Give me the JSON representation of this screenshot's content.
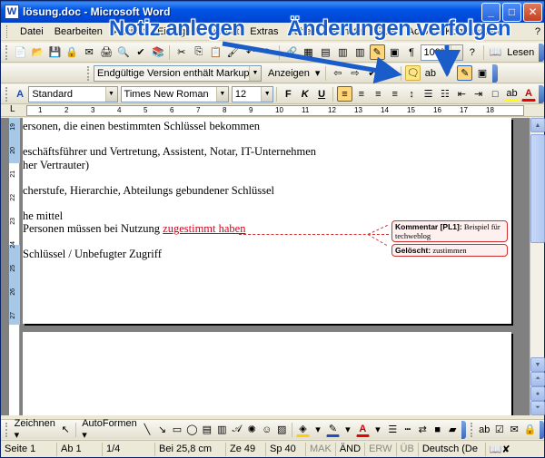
{
  "window": {
    "title": "lösung.doc - Microsoft Word",
    "minimize": "_",
    "maximize": "□",
    "close": "✕"
  },
  "menu": {
    "items": [
      "Datei",
      "Bearbeiten",
      "Ansicht",
      "Einfügen",
      "Format",
      "Extras",
      "Tabelle",
      "Fenster",
      "PDF",
      "Acrobat-Kommentare",
      "?"
    ],
    "help_search": "?"
  },
  "standard_toolbar": {
    "zoom": "100%",
    "read_button": "Lesen"
  },
  "review_toolbar": {
    "display_mode": "Endgültige Version enthält Markups",
    "show_button": "Anzeigen"
  },
  "format_toolbar": {
    "style": "Standard",
    "font": "Times New Roman",
    "size": "12",
    "bold": "F",
    "italic": "K",
    "underline": "U"
  },
  "ruler": {
    "marks": [
      "1",
      "2",
      "3",
      "4",
      "5",
      "6",
      "7",
      "8",
      "9",
      "10",
      "11",
      "12",
      "13",
      "14",
      "15",
      "16",
      "17",
      "18"
    ],
    "vertical_marks": [
      "19",
      "20",
      "21",
      "22",
      "23",
      "24",
      "25",
      "26",
      "27"
    ]
  },
  "document": {
    "lines": [
      "ersonen, die einen bestimmten Schlüssel bekommen",
      "eschäftsführer und Vertretung, Assistent, Notar, IT-Unternehmen",
      "her Vertrauter)",
      "cherstufe, Hierarchie, Abteilungs gebundener Schlüssel",
      "he mittel",
      "Schlüssel / Unbefugter Zugriff"
    ],
    "tracked_line": {
      "prefix": "Personen müssen bei Nutzung ",
      "inserted": "zuges",
      "deleted": "timmt",
      "space": " ",
      "inserted2": "haben"
    },
    "comment": {
      "label": "Kommentar [PL1]:",
      "text": "Beispiel für techweblog"
    },
    "deletion": {
      "label": "Gelöscht:",
      "text": "zustimmen"
    }
  },
  "draw_toolbar": {
    "draw_button": "Zeichnen",
    "autoshapes_button": "AutoFormen"
  },
  "statusbar": {
    "page": "Seite 1",
    "section": "Ab 1",
    "pages": "1/4",
    "position": "Bei 25,8 cm",
    "line": "Ze 49",
    "column": "Sp 40",
    "mak": "MAK",
    "and": "ÄND",
    "erw": "ERW",
    "ub": "ÜB",
    "language": "Deutsch (De"
  },
  "annotations": {
    "left": "Notiz anlegen",
    "right": "Änderungen verfolgen"
  },
  "colors": {
    "annotation": "#1a5cc9",
    "tracked_change": "#d0021b"
  }
}
